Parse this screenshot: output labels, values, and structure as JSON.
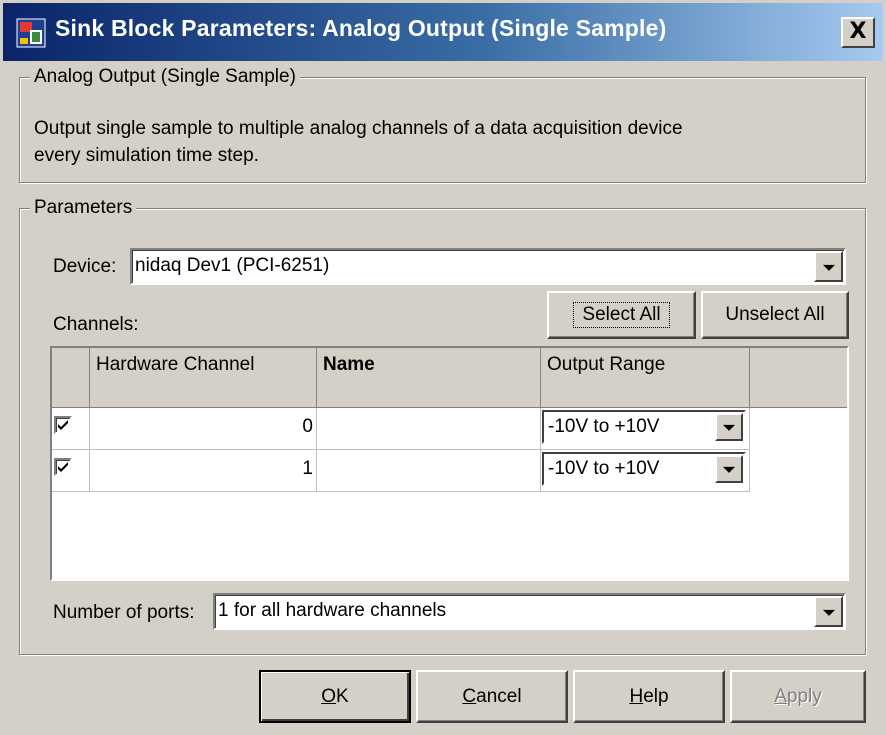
{
  "window": {
    "title": "Sink Block Parameters: Analog Output (Single Sample)",
    "close_label": "X"
  },
  "description_group": {
    "title": "Analog Output (Single Sample)",
    "text_line1": "Output single sample to multiple analog channels of a data acquisition device",
    "text_line2": "every simulation time step."
  },
  "parameters_group": {
    "title": "Parameters",
    "device_label": "Device:",
    "device_value": "nidaq Dev1 (PCI-6251)",
    "channels_label": "Channels:",
    "select_all_label": "Select All",
    "unselect_all_label": "Unselect All",
    "table": {
      "headers": [
        "Hardware Channel",
        "Name",
        "Output Range"
      ],
      "rows": [
        {
          "checked": true,
          "hardware_channel": "0",
          "name": "",
          "output_range": "-10V to +10V"
        },
        {
          "checked": true,
          "hardware_channel": "1",
          "name": "",
          "output_range": "-10V to +10V"
        }
      ]
    },
    "ports_label": "Number of ports:",
    "ports_value": "1 for all hardware channels"
  },
  "buttons": {
    "ok": {
      "label": "OK",
      "mnemonic": "O",
      "rest": "K"
    },
    "cancel": {
      "label": "Cancel",
      "mnemonic": "C",
      "rest": "ancel"
    },
    "help": {
      "label": "Help",
      "mnemonic": "H",
      "rest": "elp"
    },
    "apply": {
      "label": "Apply",
      "mnemonic": "A",
      "rest": "pply",
      "disabled": true
    }
  },
  "icons": {
    "title_icon": "simulink-block-icon",
    "dropdown_arrow": "chevron-down-icon",
    "checkbox_check": "check-icon"
  },
  "colors": {
    "titlebar_start": "#0a246a",
    "titlebar_end": "#a6caf0",
    "face": "#d4d0c8"
  }
}
